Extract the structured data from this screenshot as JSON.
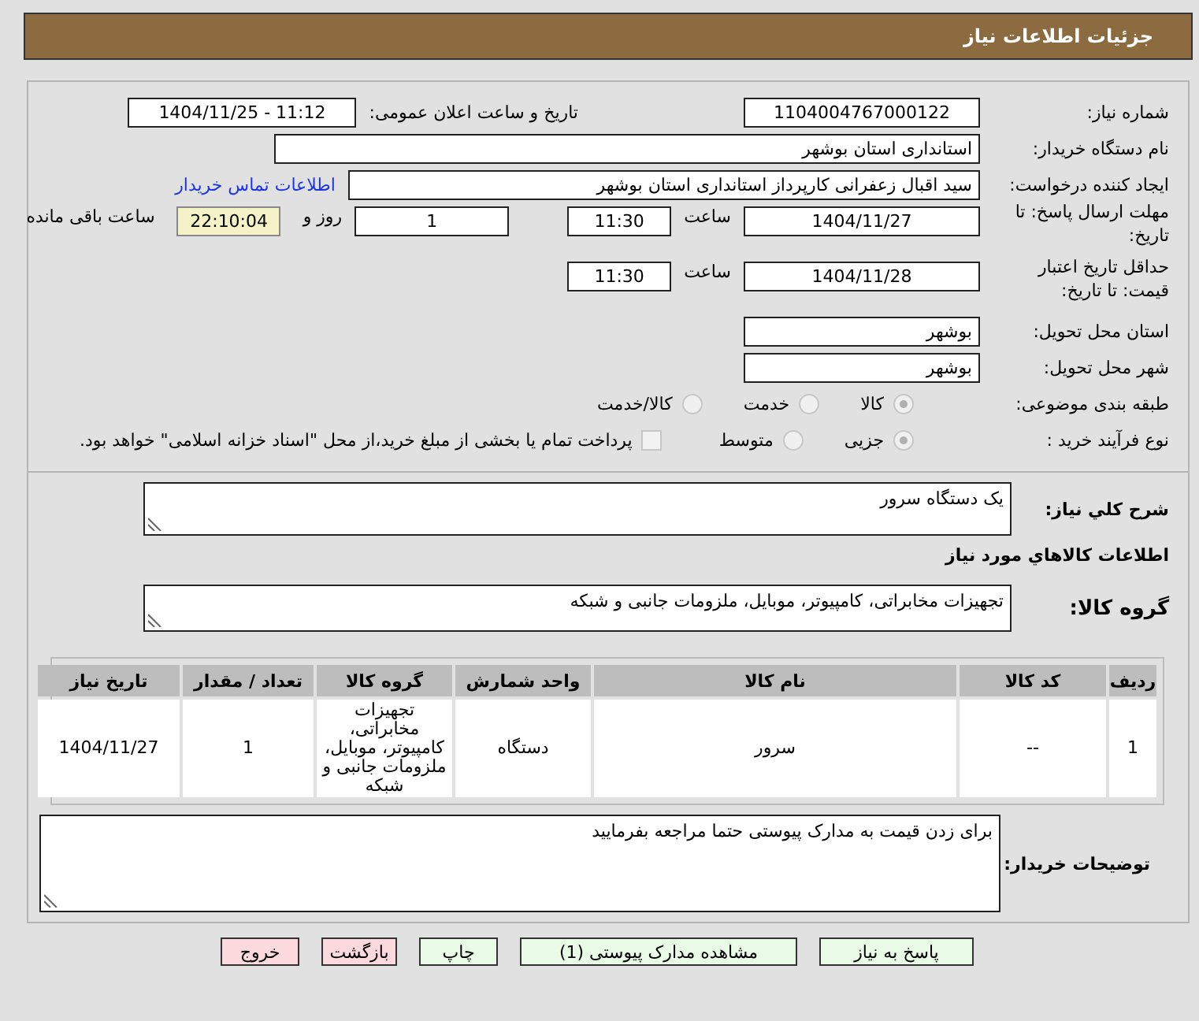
{
  "header": {
    "title": "جزئیات اطلاعات نیاز"
  },
  "need_number": {
    "label": "شماره نیاز:",
    "value": "1104004767000122"
  },
  "announce": {
    "label": "تاریخ و ساعت اعلان عمومی:",
    "value": "1404/11/25 - 11:12"
  },
  "buyer_org": {
    "label": "نام دستگاه خریدار:",
    "value": "استانداری استان بوشهر"
  },
  "requester": {
    "label": "ایجاد کننده درخواست:",
    "value": "سید اقبال زعفرانی کارپرداز استانداری استان بوشهر",
    "link": "اطلاعات تماس خریدار"
  },
  "reply_deadline": {
    "label": "مهلت ارسال پاسخ: تا تاریخ:",
    "date": "1404/11/27",
    "time_label": "ساعت",
    "time": "11:30",
    "days": "1",
    "days_label": "روز و",
    "remaining": "22:10:04",
    "remaining_label": "ساعت باقی مانده"
  },
  "price_validity": {
    "label": "حداقل تاریخ اعتبار قیمت: تا تاریخ:",
    "date": "1404/11/28",
    "time_label": "ساعت",
    "time": "11:30"
  },
  "delivery_province": {
    "label": "استان محل تحویل:",
    "value": "بوشهر"
  },
  "delivery_city": {
    "label": "شهر محل تحویل:",
    "value": "بوشهر"
  },
  "category": {
    "label": "طبقه بندی موضوعی:",
    "options": [
      {
        "label": "کالا",
        "selected": true
      },
      {
        "label": "خدمت",
        "selected": false
      },
      {
        "label": "کالا/خدمت",
        "selected": false
      }
    ]
  },
  "process": {
    "label": "نوع فرآیند خرید :",
    "options": [
      {
        "label": "جزیی",
        "selected": true
      },
      {
        "label": "متوسط",
        "selected": false
      }
    ],
    "checkbox": {
      "checked": false,
      "label": "پرداخت تمام یا بخشی از مبلغ خرید،از محل \"اسناد خزانه اسلامی\" خواهد بود."
    }
  },
  "description": {
    "label": "شرح کلي نیاز:",
    "value": "یک دستگاه سرور"
  },
  "goods_heading": "اطلاعات کالاهاي مورد نیاز",
  "goods_group": {
    "label": "گروه کالا:",
    "value": "تجهیزات مخابراتی، کامپیوتر، موبایل، ملزومات جانبی و شبکه"
  },
  "table": {
    "columns": [
      "ردیف",
      "کد کالا",
      "نام کالا",
      "واحد شمارش",
      "گروه کالا",
      "تعداد / مقدار",
      "تاریخ نیاز"
    ],
    "rows": [
      [
        "1",
        "--",
        "سرور",
        "دستگاه",
        "تجهیزات مخابراتی، کامپیوتر، موبایل، ملزومات جانبی و شبکه",
        "1",
        "1404/11/27"
      ]
    ]
  },
  "buyer_notes": {
    "label": "توضیحات خریدار:",
    "value": "برای زدن قیمت به مدارک پیوستی حتما مراجعه بفرمایید"
  },
  "buttons": [
    {
      "label": "پاسخ به نیاز",
      "kind": "normal"
    },
    {
      "label": "مشاهده مدارک پیوستی (1)",
      "kind": "normal"
    },
    {
      "label": "چاپ",
      "kind": "normal"
    },
    {
      "label": "بازگشت",
      "kind": "danger"
    },
    {
      "label": "خروج",
      "kind": "danger"
    }
  ]
}
